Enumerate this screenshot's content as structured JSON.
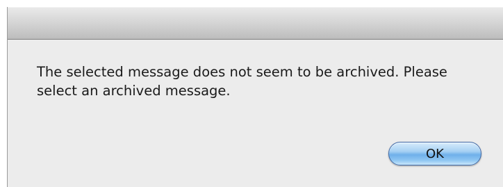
{
  "dialog": {
    "message": "The selected message does not seem to be archived. Please select an archived message.",
    "ok_label": "OK"
  }
}
